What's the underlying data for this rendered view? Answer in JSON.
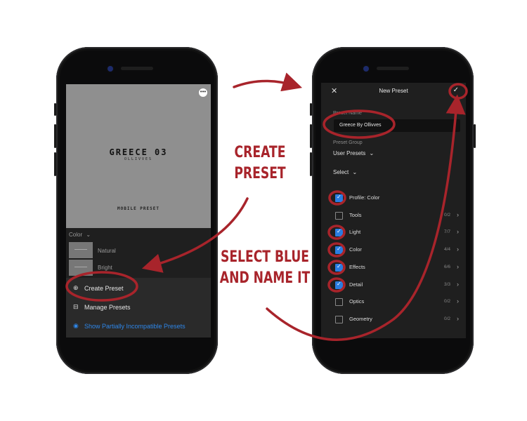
{
  "left_phone": {
    "photo": {
      "title": "GREECE 03",
      "subtitle": "OLLIVVES",
      "footer": "MOBILE PRESET",
      "more_icon": "more-icon"
    },
    "color_label": "Color",
    "presets": [
      "Natural",
      "Bright"
    ],
    "menu": {
      "create_preset": "Create Preset",
      "manage_presets": "Manage Presets",
      "show_incompatible": "Show Partially Incompatible Presets"
    }
  },
  "right_phone": {
    "header": {
      "title": "New Preset"
    },
    "preset_name_label": "Preset Name",
    "preset_name_value": "Greece By Ollivves",
    "preset_group_label": "Preset Group",
    "preset_group_value": "User Presets",
    "select_label": "Select",
    "settings": [
      {
        "name": "Profile: Color",
        "checked": true,
        "count": ""
      },
      {
        "name": "Tools",
        "checked": false,
        "count": "0/2"
      },
      {
        "name": "Light",
        "checked": true,
        "count": "7/7"
      },
      {
        "name": "Color",
        "checked": true,
        "count": "4/4"
      },
      {
        "name": "Effects",
        "checked": true,
        "count": "6/6"
      },
      {
        "name": "Detail",
        "checked": true,
        "count": "3/3"
      },
      {
        "name": "Optics",
        "checked": false,
        "count": "0/2"
      },
      {
        "name": "Geometry",
        "checked": false,
        "count": "0/2"
      }
    ]
  },
  "annotations": {
    "create_line1": "CREATE",
    "create_line2": "PRESET",
    "select_line1": "SELECT BLUE",
    "select_line2": "AND NAME IT"
  },
  "colors": {
    "annotation_red": "#a8242b",
    "checkbox_blue": "#2a7de1",
    "link_blue": "#2e86e8"
  }
}
